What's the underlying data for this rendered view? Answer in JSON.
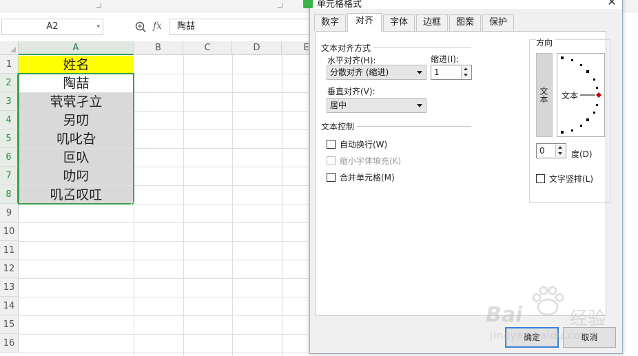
{
  "formula_bar": {
    "name_box": "A2",
    "fx_label": "fx",
    "formula_value": "陶喆",
    "zoom_icon": "magnifier-zoom-icon"
  },
  "columns": [
    "A",
    "B",
    "C",
    "D",
    "E"
  ],
  "rows": [
    "1",
    "2",
    "3",
    "4",
    "5",
    "6",
    "7",
    "8",
    "9",
    "10",
    "11",
    "12",
    "13",
    "14",
    "15",
    "16"
  ],
  "cells_A": [
    "姓名",
    "陶喆",
    "茕茕孑立",
    "另叨",
    "叽叱叴",
    "叵叺",
    "叻叼",
    "叽叾叹叿"
  ],
  "dialog": {
    "title": "单元格格式",
    "close": "✕",
    "tabs": [
      "数字",
      "对齐",
      "字体",
      "边框",
      "图案",
      "保护"
    ],
    "active_tab": 1,
    "alignment": {
      "group_title": "文本对齐方式",
      "horizontal_label": "水平对齐(H):",
      "horizontal_value": "分散对齐 (缩进)",
      "indent_label": "缩进(I):",
      "indent_value": "1",
      "vertical_label": "垂直对齐(V):",
      "vertical_value": "居中"
    },
    "text_control": {
      "group_title": "文本控制",
      "wrap": "自动换行(W)",
      "shrink": "缩小字体填充(K)",
      "merge": "合并单元格(M)"
    },
    "orientation": {
      "group_title": "方向",
      "vertical_text": "文本",
      "dial_text": "文本",
      "degrees_value": "0",
      "degrees_label": "度(D)",
      "vertical_layout": "文字竖排(L)"
    },
    "ok": "确定",
    "cancel": "取消"
  },
  "watermark": {
    "brand": "Bai",
    "brand_cn": "经验",
    "url": "jingyan.baidu.com"
  },
  "colors": {
    "header_fill": "#ffff00",
    "selection_fill": "#d9d9d9",
    "selection_border": "#3aa04a",
    "dialog_bg": "#f0f0f0",
    "ok_border": "#3c7fd8"
  }
}
